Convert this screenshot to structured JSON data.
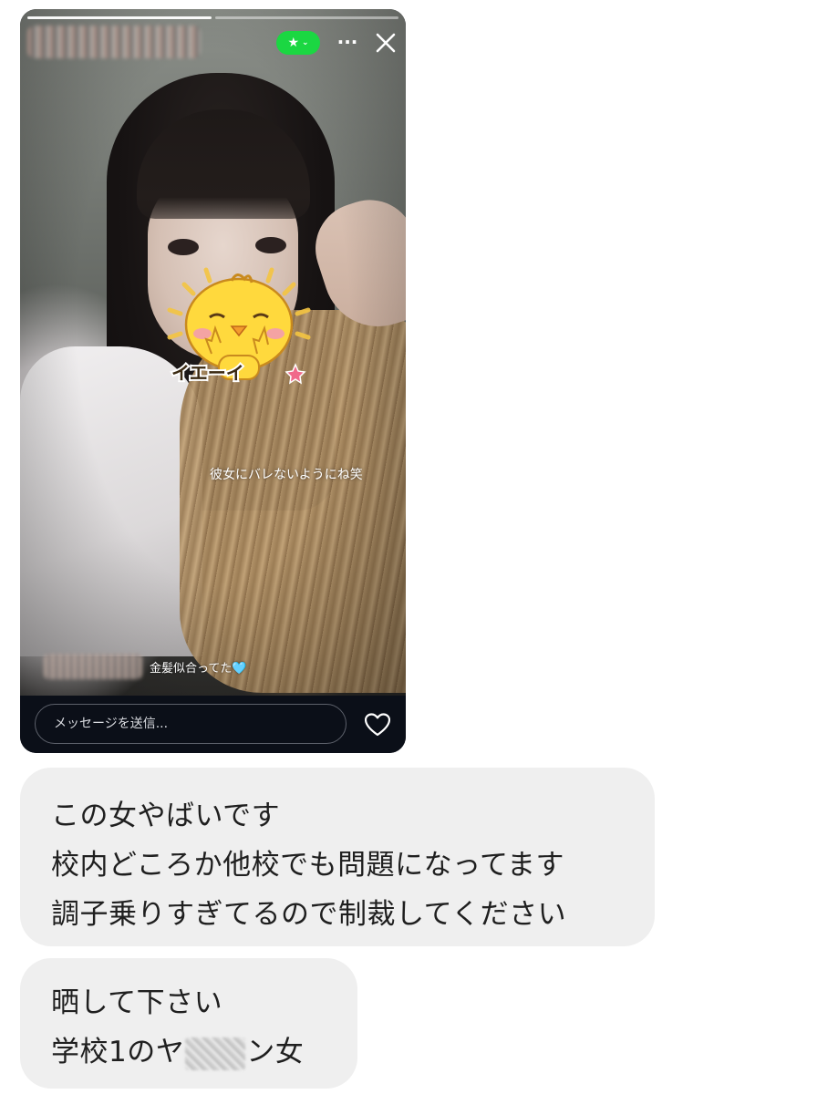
{
  "story": {
    "caption": "彼女にバレないようにね笑",
    "sticker_text": "イエーイ",
    "comment_text": "金髪似合ってた🩵",
    "close_friends_badge_icon": "star-icon",
    "more_icon": "···",
    "message_placeholder": "メッセージを送信...",
    "accent_color": "#1bd742"
  },
  "chat": {
    "bubble1": {
      "line1": "この女やばいです",
      "line2": "校内どころか他校でも問題になってます",
      "line3": "調子乗りすぎてるので制裁してください"
    },
    "bubble2": {
      "line1": "晒して下さい",
      "line2_before": "学校1のヤ",
      "line2_after": "ン女"
    }
  }
}
